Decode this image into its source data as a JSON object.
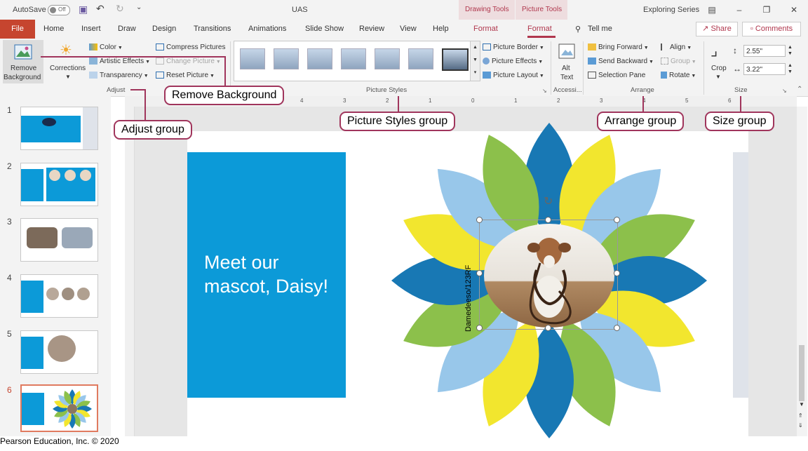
{
  "titlebar": {
    "autosave": "AutoSave",
    "autosave_state": "Off",
    "doc_title": "UAS",
    "drawing_tools": "Drawing Tools",
    "picture_tools": "Picture Tools",
    "account": "Exploring Series"
  },
  "tabs": [
    "File",
    "Home",
    "Insert",
    "Draw",
    "Design",
    "Transitions",
    "Animations",
    "Slide Show",
    "Review",
    "View",
    "Help"
  ],
  "context_tabs": [
    "Format",
    "Format"
  ],
  "tell_me": "Tell me",
  "share": "Share",
  "comments": "Comments",
  "ribbon": {
    "remove_background": [
      "Remove",
      "Background"
    ],
    "corrections": "Corrections",
    "color": "Color",
    "artistic_effects": "Artistic Effects",
    "transparency": "Transparency",
    "compress_pictures": "Compress Pictures",
    "change_picture": "Change Picture",
    "reset_picture": "Reset Picture",
    "adjust": "Adjust",
    "picture_styles": "Picture Styles",
    "picture_border": "Picture Border",
    "picture_effects": "Picture Effects",
    "picture_layout": "Picture Layout",
    "alt_text": [
      "Alt",
      "Text"
    ],
    "accessibility": "Accessi...",
    "bring_forward": "Bring Forward",
    "send_backward": "Send Backward",
    "selection_pane": "Selection Pane",
    "align": "Align",
    "group": "Group",
    "rotate": "Rotate",
    "arrange": "Arrange",
    "crop": "Crop",
    "height": "2.55\"",
    "width": "3.22\"",
    "size": "Size"
  },
  "ruler": [
    "4",
    "3",
    "2",
    "1",
    "0",
    "1",
    "2",
    "3",
    "4",
    "5",
    "6"
  ],
  "slide_numbers": [
    "1",
    "2",
    "3",
    "4",
    "5",
    "6"
  ],
  "slide_text": [
    "Meet our",
    "mascot, Daisy!"
  ],
  "photo_credit": "Damedeeso/123RF",
  "callouts": {
    "remove_background": "Remove Background",
    "adjust_group": "Adjust group",
    "picture_styles_group": "Picture Styles group",
    "arrange_group": "Arrange group",
    "size_group": "Size group"
  },
  "credit": "Pearson Education, Inc. © 2020",
  "colors": {
    "accent": "#b0374d",
    "file_tab": "#c6452f",
    "slide_blue": "#0c9ad8",
    "callout_border": "#a0355c"
  }
}
